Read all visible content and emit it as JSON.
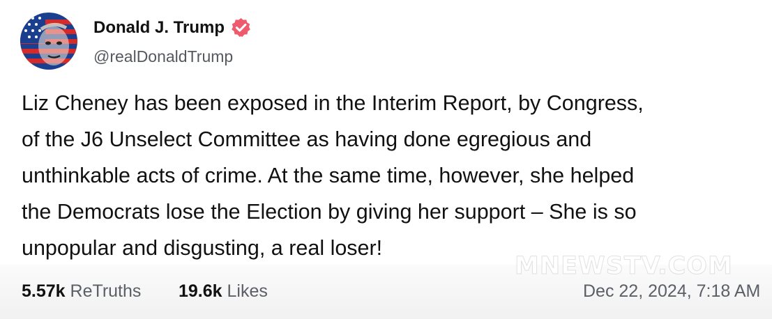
{
  "author": {
    "display_name": "Donald J. Trump",
    "handle": "@realDonaldTrump",
    "verified": true,
    "verified_badge_color": "#ee5a6e",
    "avatar_icon": "avatar-flag-portrait-icon"
  },
  "post": {
    "text": "Liz Cheney has been exposed in the Interim Report, by Congress,\nof the J6 Unselect Committee as having done egregious and\nunthinkable acts of crime. At the same time, however, she helped\nthe Democrats lose the Election by giving her support – She is so\nunpopular and disgusting, a real loser!"
  },
  "stats": {
    "retruths_count": "5.57k",
    "retruths_label": "ReTruths",
    "likes_count": "19.6k",
    "likes_label": "Likes"
  },
  "timestamp": "Dec 22, 2024, 7:18 AM",
  "watermark": "MNEWSTV.COM",
  "colors": {
    "background": "#ffffff",
    "footer_background": "#f3f3f3",
    "text_primary": "#111111",
    "text_secondary": "#5b5f66"
  }
}
